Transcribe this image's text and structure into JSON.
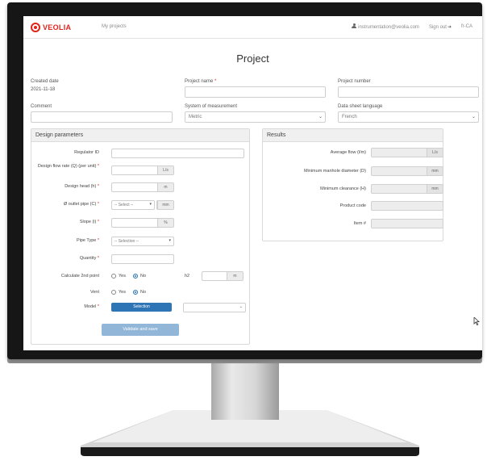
{
  "header": {
    "logo_text": "VEOLIA",
    "nav_link": "My projects",
    "user_email": "instrumentation@veolia.com",
    "sign_out": "Sign out",
    "lang": "fr-CA"
  },
  "page": {
    "title": "Project"
  },
  "form": {
    "created_date_label": "Created date",
    "created_date_value": "2021-11-18",
    "project_name_label": "Project name",
    "project_name_required": "*",
    "project_name_value": "",
    "project_number_label": "Project number",
    "project_number_value": "",
    "comment_label": "Comment",
    "comment_value": "",
    "measurement_label": "System of measurement",
    "measurement_value": "Metric",
    "datasheet_label": "Data sheet language",
    "datasheet_value": "French"
  },
  "design": {
    "title": "Design parameters",
    "regulator_label": "Regulator ID",
    "flow_label": "Design flow rate (Q) (per unit)",
    "flow_unit": "L/s",
    "head_label": "Design head (h)",
    "head_unit": "m",
    "outlet_label": "Ø outlet pipe (C)",
    "outlet_placeholder": "-- Select --",
    "outlet_unit": "mm",
    "slope_label": "Slope (i)",
    "slope_unit": "%",
    "pipe_label": "Pipe Type",
    "pipe_placeholder": "-- Selection --",
    "quantity_label": "Quantity",
    "second_point_label": "Calculate 2nd point",
    "yes": "Yes",
    "no": "No",
    "h2_label": "h2",
    "h2_unit": "m",
    "vent_label": "Vent",
    "model_label": "Model",
    "model_button": "Selection",
    "validate_button": "Validate and save",
    "required_mark": "*"
  },
  "results": {
    "title": "Results",
    "avg_flow_label": "Average flow (l/m)",
    "avg_flow_unit": "L/s",
    "manhole_label": "Minimum manhole diameter (D)",
    "manhole_unit": "mm",
    "clearance_label": "Minimum clearance (H)",
    "clearance_unit": "mm",
    "product_code_label": "Product code",
    "item_label": "Item #"
  },
  "colors": {
    "brand_red": "#e2231a",
    "primary_blue": "#2e75b6",
    "bezel": "#161616"
  }
}
